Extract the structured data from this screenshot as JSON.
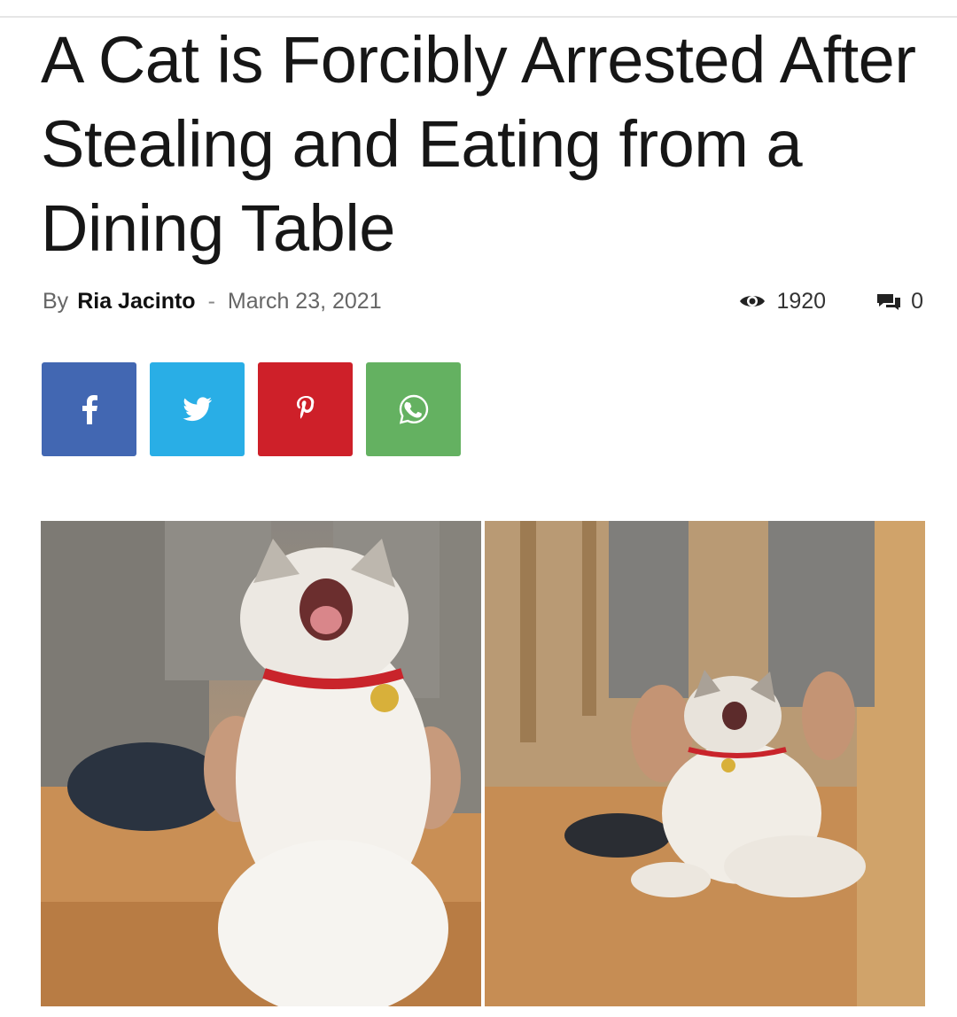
{
  "article": {
    "title": "A Cat is Forcibly Arrested After Stealing and Eating from a Dining Table",
    "by_label": "By",
    "author": "Ria Jacinto",
    "separator": "-",
    "date": "March 23, 2021",
    "views": "1920",
    "comments": "0"
  },
  "share": {
    "buttons": [
      {
        "network": "facebook",
        "icon": "facebook-icon",
        "color": "#4267b2"
      },
      {
        "network": "twitter",
        "icon": "twitter-icon",
        "color": "#29aee6"
      },
      {
        "network": "pinterest",
        "icon": "pinterest-icon",
        "color": "#ce2029"
      },
      {
        "network": "whatsapp",
        "icon": "whatsapp-icon",
        "color": "#64b161"
      }
    ]
  },
  "images": [
    {
      "name": "cat-photo-left"
    },
    {
      "name": "cat-photo-right"
    }
  ]
}
